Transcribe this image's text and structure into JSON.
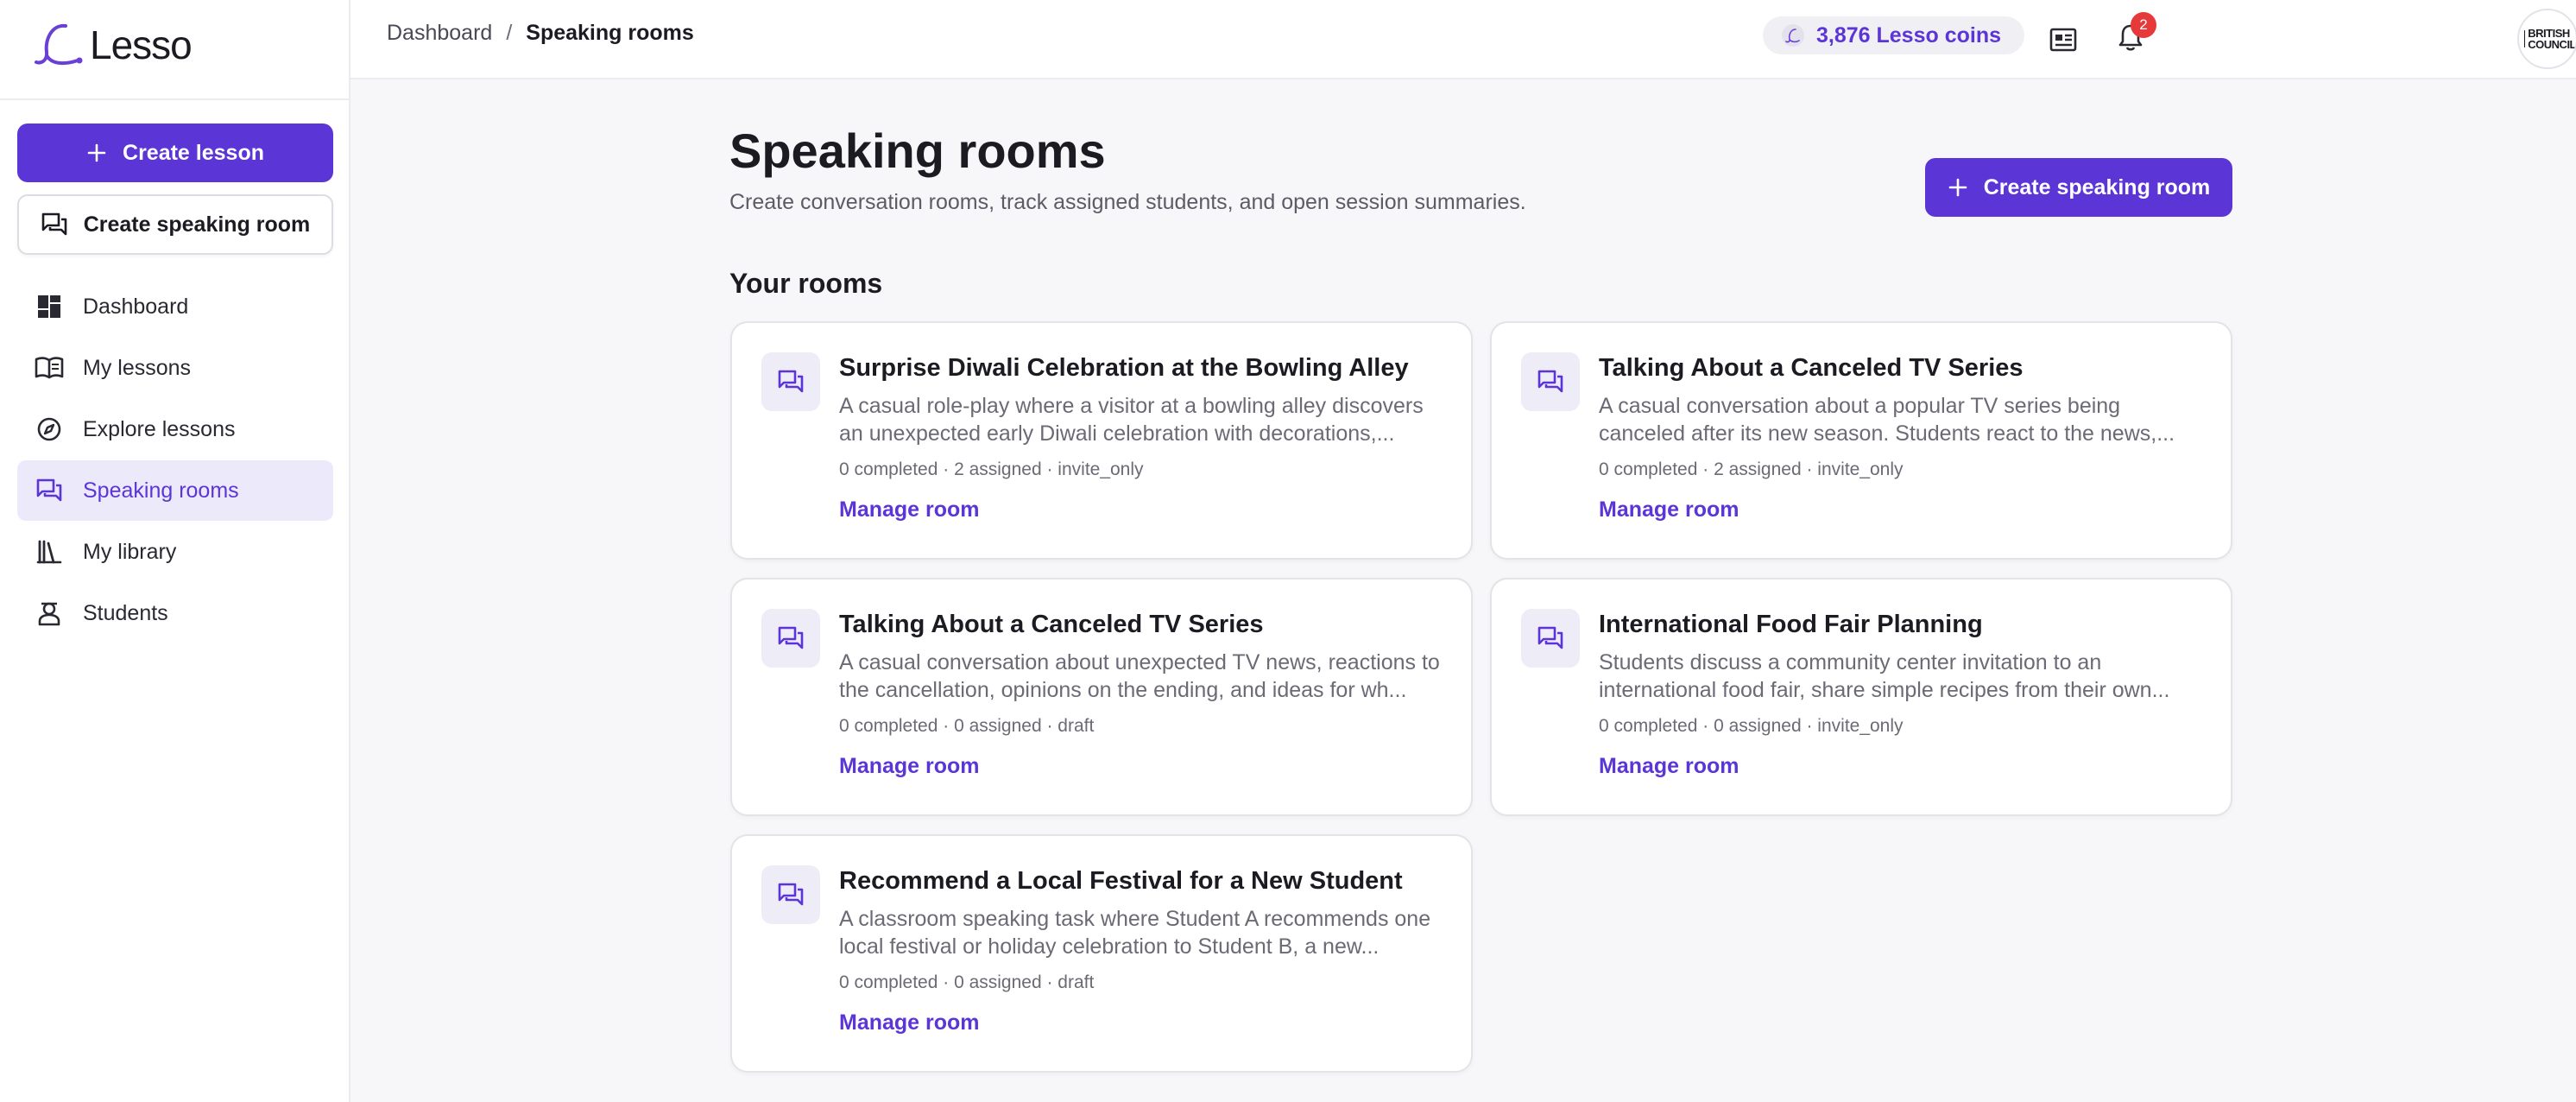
{
  "app": {
    "name": "Lesso"
  },
  "sidebar": {
    "create_lesson": "Create lesson",
    "create_speaking_room": "Create speaking room",
    "items": [
      {
        "label": "Dashboard",
        "icon": "dashboard-icon"
      },
      {
        "label": "My lessons",
        "icon": "book-icon"
      },
      {
        "label": "Explore lessons",
        "icon": "compass-icon"
      },
      {
        "label": "Speaking rooms",
        "icon": "chat-icon",
        "active": true
      },
      {
        "label": "My library",
        "icon": "library-icon"
      },
      {
        "label": "Students",
        "icon": "student-icon"
      }
    ]
  },
  "topbar": {
    "breadcrumb": [
      "Dashboard",
      "/",
      "Speaking rooms"
    ],
    "coins": "3,876 Lesso coins",
    "notification_count": "2",
    "avatar_text": "BRITISH COUNCIL"
  },
  "main": {
    "title": "Speaking rooms",
    "subtitle": "Create conversation rooms, track assigned students, and open session summaries.",
    "create_button": "Create speaking room",
    "section_title": "Your rooms",
    "rooms": [
      {
        "title": "Surprise Diwali Celebration at the Bowling Alley",
        "desc": "A casual role-play where a visitor at a bowling alley discovers an unexpected early Diwali celebration with decorations,...",
        "meta": "0 completed · 2 assigned · invite_only",
        "link": "Manage room"
      },
      {
        "title": "Talking About a Canceled TV Series",
        "desc": "A casual conversation about a popular TV series being canceled after its new season. Students react to the news,...",
        "meta": "0 completed · 2 assigned · invite_only",
        "link": "Manage room"
      },
      {
        "title": "Talking About a Canceled TV Series",
        "desc": "A casual conversation about unexpected TV news, reactions to the cancellation, opinions on the ending, and ideas for wh...",
        "meta": "0 completed · 0 assigned · draft",
        "link": "Manage room"
      },
      {
        "title": "International Food Fair Planning",
        "desc": "Students discuss a community center invitation to an international food fair, share simple recipes from their own...",
        "meta": "0 completed · 0 assigned · invite_only",
        "link": "Manage room"
      },
      {
        "title": "Recommend a Local Festival for a New Student",
        "desc": "A classroom speaking task where Student A recommends one local festival or holiday celebration to Student B, a new...",
        "meta": "0 completed · 0 assigned · draft",
        "link": "Manage room"
      }
    ]
  },
  "colors": {
    "accent": "#5b35d5",
    "accent_soft": "#ece9fb",
    "badge": "#e5393a"
  }
}
